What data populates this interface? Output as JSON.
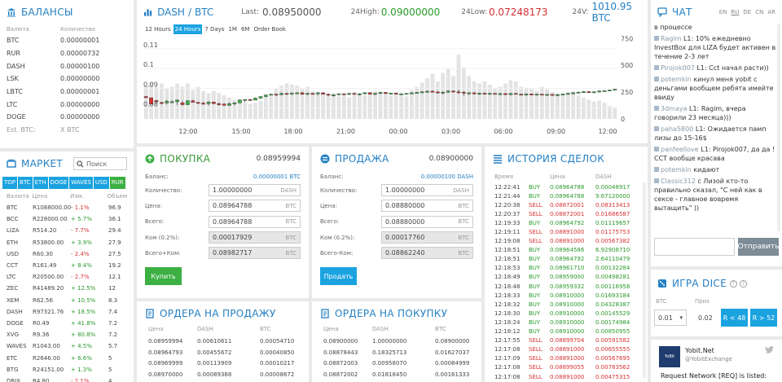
{
  "balances": {
    "title": "БАЛАНСЫ",
    "col_currency": "Валюта",
    "col_amount": "Количество",
    "rows": [
      [
        "BTC",
        "0.00000001"
      ],
      [
        "RUR",
        "0.00000732"
      ],
      [
        "DASH",
        "0.00000100"
      ],
      [
        "LSK",
        "0.00000000"
      ],
      [
        "LBTC",
        "0.00000001"
      ],
      [
        "LTC",
        "0.00000000"
      ],
      [
        "DOGE",
        "0.00000000"
      ]
    ],
    "est_label": "Est. BTC:",
    "est_value": "X BTC"
  },
  "market": {
    "title": "МАРКЕТ",
    "search_placeholder": "Поиск",
    "tabs": [
      "TOP",
      "BTC",
      "ETH",
      "DOGE",
      "WAVES",
      "USD",
      "RUR"
    ],
    "col_currency": "Валюта",
    "col_price": "Цена",
    "col_change": "Изм.",
    "col_volume": "Объем",
    "rows": [
      [
        "BTC",
        "R1088000.00",
        "- 1.1%",
        "96.9"
      ],
      [
        "BCC",
        "R228000.00",
        "+ 5.7%",
        "36.1"
      ],
      [
        "LIZA",
        "R514.20",
        "- 7.7%",
        "29.4"
      ],
      [
        "ETH",
        "R53800.00",
        "+ 3.9%",
        "27.9"
      ],
      [
        "USD",
        "R60.30",
        "- 2.4%",
        "27.5"
      ],
      [
        "CCT",
        "R161.49",
        "+ 8.4%",
        "19.2"
      ],
      [
        "LTC",
        "R20500.00",
        "- 2.7%",
        "12.1"
      ],
      [
        "ZEC",
        "R41489.20",
        "+ 12.5%",
        "12"
      ],
      [
        "XEM",
        "R62.56",
        "+ 10.5%",
        "8.3"
      ],
      [
        "DASH",
        "R97321.76",
        "+ 18.5%",
        "7.4"
      ],
      [
        "DOGE",
        "R0.49",
        "+ 41.8%",
        "7.2"
      ],
      [
        "XVG",
        "R9.36",
        "+ 80.8%",
        "7.2"
      ],
      [
        "WAVES",
        "R1043.00",
        "+ 4.5%",
        "5.7"
      ],
      [
        "ETC",
        "R2646.00",
        "+ 6.6%",
        "5"
      ],
      [
        "BTG",
        "R24151.00",
        "+ 1.3%",
        "5"
      ],
      [
        "DBIX",
        "R4.80",
        "- 2.1%",
        "4"
      ]
    ]
  },
  "ticker": {
    "pair_base": "DASH",
    "pair_sep": "/",
    "pair_quote": "BTC",
    "last_label": "Last:",
    "last_value": "0.08950000",
    "high_label": "24High:",
    "high_value": "0.09000000",
    "low_label": "24Low:",
    "low_value": "0.07248173",
    "vol_label": "24V:",
    "vol_value": "1010.95 BTC"
  },
  "chart_tabs": [
    "12 Hours",
    "24 Hours",
    "7 Days",
    "1M",
    "6M",
    "Order Book"
  ],
  "chart_data": {
    "type": "candlestick",
    "x_ticks": [
      "12:00",
      "15:00",
      "18:00",
      "21:00",
      "00:00",
      "03:00",
      "06:00",
      "09:00",
      "12:00"
    ],
    "y_ticks": [
      "0.11",
      "0.1",
      "0.09",
      "0.08"
    ],
    "y2_ticks": [
      "750",
      "500",
      "250",
      "0"
    ],
    "ylim": [
      0.0745,
      0.1165
    ],
    "y2lim": [
      0,
      775
    ],
    "candles": [
      [
        0.0858,
        0.0858,
        0.0852,
        0.0851,
        0.0861,
        310
      ],
      [
        0.0852,
        0.0838,
        0.082,
        0.0822,
        0.0836,
        340
      ],
      [
        0.0838,
        0.0828,
        0.0835,
        0.0827,
        0.084,
        300
      ],
      [
        0.0828,
        0.082,
        0.0826,
        0.0818,
        0.0831,
        330
      ],
      [
        0.0826,
        0.082,
        0.0834,
        0.0818,
        0.0842,
        280
      ],
      [
        0.0831,
        0.0826,
        0.0832,
        0.0824,
        0.0839,
        300
      ],
      [
        0.0832,
        0.0819,
        0.084,
        0.0816,
        0.0844,
        330
      ],
      [
        0.0826,
        0.0831,
        0.0817,
        0.0813,
        0.0837,
        300
      ],
      [
        0.0817,
        0.0831,
        0.0837,
        0.0815,
        0.0839,
        330
      ],
      [
        0.0837,
        0.084,
        0.0829,
        0.0828,
        0.0842,
        270
      ],
      [
        0.0829,
        0.082,
        0.0824,
        0.0818,
        0.0828,
        300
      ],
      [
        0.0824,
        0.083,
        0.0822,
        0.082,
        0.0832,
        260
      ],
      [
        0.0822,
        0.0816,
        0.083,
        0.0813,
        0.0835,
        240
      ],
      [
        0.083,
        0.0826,
        0.0822,
        0.082,
        0.0832,
        260
      ],
      [
        0.0822,
        0.0814,
        0.082,
        0.0812,
        0.0827,
        240
      ],
      [
        0.082,
        0.0812,
        0.0814,
        0.081,
        0.0824,
        220
      ],
      [
        0.0814,
        0.0812,
        0.0822,
        0.081,
        0.0828,
        200
      ],
      [
        0.0822,
        0.0815,
        0.0826,
        0.0813,
        0.083,
        180
      ],
      [
        0.0826,
        0.0833,
        0.0841,
        0.0823,
        0.0844,
        170
      ],
      [
        0.0841,
        0.0831,
        0.0843,
        0.0829,
        0.0846,
        150
      ],
      [
        0.0843,
        0.0838,
        0.084,
        0.0835,
        0.0847,
        140
      ],
      [
        0.084,
        0.0842,
        0.085,
        0.0839,
        0.0854,
        150
      ],
      [
        0.085,
        0.0847,
        0.0858,
        0.0845,
        0.0861,
        170
      ],
      [
        0.0858,
        0.0856,
        0.0866,
        0.0853,
        0.0869,
        200
      ],
      [
        0.0866,
        0.0867,
        0.087,
        0.0863,
        0.0873,
        230
      ],
      [
        0.087,
        0.0862,
        0.0868,
        0.086,
        0.0873,
        280
      ],
      [
        0.0868,
        0.0866,
        0.0874,
        0.0864,
        0.0878,
        310
      ],
      [
        0.0874,
        0.0868,
        0.0872,
        0.0866,
        0.0877,
        330
      ],
      [
        0.0872,
        0.0867,
        0.0876,
        0.0865,
        0.0879,
        320
      ],
      [
        0.0876,
        0.0872,
        0.0877,
        0.087,
        0.088,
        310
      ],
      [
        0.0877,
        0.088,
        0.087,
        0.0866,
        0.0882,
        280
      ],
      [
        0.087,
        0.0868,
        0.0874,
        0.0866,
        0.0877,
        300
      ],
      [
        0.0874,
        0.0869,
        0.0873,
        0.0867,
        0.0876,
        260
      ],
      [
        0.0873,
        0.0866,
        0.0877,
        0.0864,
        0.088,
        250
      ],
      [
        0.0877,
        0.0873,
        0.087,
        0.0868,
        0.088,
        240
      ],
      [
        0.087,
        0.0862,
        0.0865,
        0.086,
        0.0873,
        230
      ],
      [
        0.0865,
        0.086,
        0.0867,
        0.0858,
        0.087,
        240
      ],
      [
        0.0867,
        0.0865,
        0.0872,
        0.0863,
        0.0875,
        210
      ],
      [
        0.0872,
        0.087,
        0.0869,
        0.0866,
        0.0876,
        230
      ],
      [
        0.0869,
        0.0866,
        0.0874,
        0.0864,
        0.0877,
        200
      ],
      [
        0.0874,
        0.0872,
        0.087,
        0.0868,
        0.0877,
        250
      ],
      [
        0.087,
        0.0866,
        0.0872,
        0.0864,
        0.0875,
        240
      ],
      [
        0.0872,
        0.087,
        0.0878,
        0.0868,
        0.088,
        220
      ],
      [
        0.0878,
        0.0876,
        0.087,
        0.0868,
        0.088,
        230
      ],
      [
        0.087,
        0.0867,
        0.0874,
        0.0865,
        0.0877,
        260
      ],
      [
        0.0874,
        0.0872,
        0.0879,
        0.087,
        0.0882,
        250
      ],
      [
        0.0879,
        0.0876,
        0.0873,
        0.0871,
        0.0881,
        240
      ],
      [
        0.0873,
        0.087,
        0.0875,
        0.0868,
        0.0878,
        220
      ],
      [
        0.0875,
        0.0873,
        0.0871,
        0.0869,
        0.0877,
        250
      ],
      [
        0.0871,
        0.0869,
        0.0872,
        0.0867,
        0.0875,
        230
      ],
      [
        0.0872,
        0.087,
        0.0874,
        0.0868,
        0.0876,
        210
      ],
      [
        0.0874,
        0.0872,
        0.0877,
        0.087,
        0.088,
        270
      ],
      [
        0.0877,
        0.0875,
        0.0879,
        0.0873,
        0.0882,
        300
      ],
      [
        0.0879,
        0.0877,
        0.0882,
        0.0875,
        0.0885,
        340
      ],
      [
        0.0882,
        0.088,
        0.0885,
        0.0878,
        0.0889,
        380
      ],
      [
        0.0885,
        0.0887,
        0.0881,
        0.0879,
        0.089,
        420
      ],
      [
        0.0881,
        0.0883,
        0.0876,
        0.0874,
        0.0887,
        350
      ],
      [
        0.0876,
        0.0874,
        0.088,
        0.087,
        0.0885,
        430
      ],
      [
        0.088,
        0.0878,
        0.0886,
        0.0876,
        0.089,
        470
      ],
      [
        0.0886,
        0.088,
        0.0882,
        0.0878,
        0.0888,
        400
      ],
      [
        0.0882,
        0.0886,
        0.088,
        0.0872,
        0.0893,
        600
      ],
      [
        0.088,
        0.0882,
        0.0876,
        0.0862,
        0.0886,
        480
      ],
      [
        0.0876,
        0.0872,
        0.0877,
        0.0866,
        0.088,
        400
      ],
      [
        0.0877,
        0.0875,
        0.0872,
        0.0868,
        0.088,
        350
      ],
      [
        0.0872,
        0.087,
        0.0875,
        0.0867,
        0.0878,
        330
      ],
      [
        0.0875,
        0.0873,
        0.0871,
        0.0869,
        0.0878,
        350
      ],
      [
        0.0871,
        0.0869,
        0.0874,
        0.0867,
        0.0877,
        320
      ],
      [
        0.0874,
        0.0872,
        0.087,
        0.0868,
        0.0876,
        290
      ],
      [
        0.087,
        0.0867,
        0.0873,
        0.0865,
        0.0876,
        300
      ],
      [
        0.0873,
        0.0871,
        0.0868,
        0.0866,
        0.0875,
        330
      ],
      [
        0.0868,
        0.0866,
        0.0874,
        0.0864,
        0.0877,
        360
      ],
      [
        0.0874,
        0.0872,
        0.087,
        0.0868,
        0.0876,
        350
      ],
      [
        0.087,
        0.0868,
        0.0866,
        0.0864,
        0.0873,
        300
      ],
      [
        0.0866,
        0.0864,
        0.0871,
        0.0862,
        0.0874,
        290
      ],
      [
        0.0871,
        0.0869,
        0.0867,
        0.0865,
        0.0873,
        280
      ],
      [
        0.0867,
        0.0865,
        0.087,
        0.0863,
        0.0873,
        260
      ],
      [
        0.087,
        0.0868,
        0.0866,
        0.0864,
        0.0872,
        300
      ],
      [
        0.0866,
        0.0864,
        0.0869,
        0.0862,
        0.0872,
        280
      ],
      [
        0.0869,
        0.0867,
        0.0864,
        0.0862,
        0.0871,
        250
      ],
      [
        0.0864,
        0.0862,
        0.0868,
        0.086,
        0.0871,
        240
      ],
      [
        0.0868,
        0.0866,
        0.0871,
        0.0864,
        0.0874,
        230
      ],
      [
        0.0871,
        0.0869,
        0.0874,
        0.0867,
        0.0877,
        250
      ],
      [
        0.0874,
        0.0872,
        0.0877,
        0.087,
        0.088,
        260
      ],
      [
        0.0877,
        0.0875,
        0.088,
        0.0873,
        0.0884,
        220
      ],
      [
        0.088,
        0.0878,
        0.0883,
        0.0876,
        0.0886,
        200
      ],
      [
        0.0883,
        0.0881,
        0.0878,
        0.0876,
        0.0885,
        180
      ],
      [
        0.0878,
        0.0877,
        0.0882,
        0.0875,
        0.0885,
        160
      ],
      [
        0.0882,
        0.088,
        0.0886,
        0.0878,
        0.0889,
        170
      ],
      [
        0.0886,
        0.0884,
        0.0888,
        0.0882,
        0.0891,
        150
      ],
      [
        0.0888,
        0.0887,
        0.0891,
        0.0885,
        0.0893,
        120
      ],
      [
        0.0891,
        0.089,
        0.0895,
        0.0888,
        0.0897,
        110
      ]
    ]
  },
  "buy": {
    "title": "ПОКУПКА",
    "price": "0.08959994",
    "balance_label": "Баланс:",
    "balance_value": "0.00000001 BTC",
    "qty_label": "Количество:",
    "qty_value": "1.00000000",
    "qty_unit": "DASH",
    "price_label": "Цена:",
    "price_value": "0.08964788",
    "price_unit": "BTC",
    "total_label": "Всего:",
    "total_value": "0.08964788",
    "total_unit": "BTC",
    "fee_label": "Ком (0.2%):",
    "fee_value": "0.00017929",
    "fee_unit": "BTC",
    "totalfee_label": "Всего+Ком:",
    "totalfee_value": "0.08982717",
    "totalfee_unit": "BTC",
    "button": "Купить"
  },
  "sell": {
    "title": "ПРОДАЖА",
    "price": "0.08900000",
    "balance_label": "Баланс:",
    "balance_value": "0.00000100 DASH",
    "qty_label": "Количество:",
    "qty_value": "1.00000000",
    "qty_unit": "DASH",
    "price_label": "Цена:",
    "price_value": "0.08880000",
    "price_unit": "BTC",
    "total_label": "Всего:",
    "total_value": "0.08880000",
    "total_unit": "BTC",
    "fee_label": "Ком (0.2%):",
    "fee_value": "0.00017760",
    "fee_unit": "BTC",
    "totalfee_label": "Всего-Ком:",
    "totalfee_value": "0.08862240",
    "totalfee_unit": "BTC",
    "button": "Продать"
  },
  "sell_orders": {
    "title": "ОРДЕРА НА ПРОДАЖУ",
    "col_price": "Цена",
    "col_dash": "DASH",
    "col_btc": "BTC",
    "rows": [
      [
        "0.08959994",
        "0.00610611",
        "0.00054710"
      ],
      [
        "0.08964793",
        "0.00455672",
        "0.00040850"
      ],
      [
        "0.08969999",
        "0.00113909",
        "0.00010217"
      ],
      [
        "0.08970000",
        "0.00089368",
        "0.00008672"
      ]
    ]
  },
  "buy_orders": {
    "title": "ОРДЕРА НА ПОКУПКУ",
    "col_price": "Цена",
    "col_dash": "DASH",
    "col_btc": "BTC",
    "rows": [
      [
        "0.08900000",
        "1.00000000",
        "0.08900000"
      ],
      [
        "0.08878443",
        "0.18325713",
        "0.01627037"
      ],
      [
        "0.08872003",
        "0.00958070",
        "0.00084999"
      ],
      [
        "0.08872002",
        "0.01818450",
        "0.00161333"
      ]
    ]
  },
  "history": {
    "title": "ИСТОРИЯ СДЕЛОК",
    "col_time": "Время",
    "col_price": "Цена",
    "col_dash": "DASH",
    "rows": [
      [
        "12:22:41",
        "BUY",
        "0.08964788",
        "0.00048917"
      ],
      [
        "12:21:44",
        "BUY",
        "0.08964788",
        "9.67120000"
      ],
      [
        "12:20:38",
        "SELL",
        "0.08872001",
        "0.08313413"
      ],
      [
        "12:20:37",
        "SELL",
        "0.08872001",
        "0.01686587"
      ],
      [
        "12:19:33",
        "BUY",
        "0.08964792",
        "0.01119657"
      ],
      [
        "12:19:11",
        "SELL",
        "0.08891000",
        "0.01175753"
      ],
      [
        "12:19:08",
        "SELL",
        "0.08891000",
        "0.00567382"
      ],
      [
        "12:18:51",
        "BUY",
        "0.08964586",
        "6.92908710"
      ],
      [
        "12:18:51",
        "BUY",
        "0.08964792",
        "2.64110479"
      ],
      [
        "12:18:53",
        "BUY",
        "0.08961710",
        "0.00132284"
      ],
      [
        "12:18:49",
        "BUY",
        "0.08959000",
        "0.00498281"
      ],
      [
        "12:18:48",
        "BUY",
        "0.08959332",
        "0.00116958"
      ],
      [
        "12:18:33",
        "BUY",
        "0.08910000",
        "0.01693184"
      ],
      [
        "12:18:32",
        "BUY",
        "0.08910000",
        "0.04328387"
      ],
      [
        "12:18:30",
        "BUY",
        "0.08910000",
        "0.00145529"
      ],
      [
        "12:18:24",
        "BUY",
        "0.08910000",
        "0.00174984"
      ],
      [
        "12:18:12",
        "BUY",
        "0.08910000",
        "0.00850955"
      ],
      [
        "12:17:55",
        "SELL",
        "0.08899704",
        "0.00591582"
      ],
      [
        "12:17:08",
        "SELL",
        "0.08891000",
        "0.00655555"
      ],
      [
        "12:17:09",
        "SELL",
        "0.08891000",
        "0.00567695"
      ],
      [
        "12:17:08",
        "SELL",
        "0.08899055",
        "0.00783562"
      ],
      [
        "12:17:08",
        "SELL",
        "0.08891000",
        "0.00475315"
      ]
    ]
  },
  "chat": {
    "title": "ЧАТ",
    "langs": [
      "EN",
      "RU",
      "DE",
      "CN",
      "AR"
    ],
    "active_lang": "RU",
    "messages": [
      {
        "user": "",
        "text": "в процессе"
      },
      {
        "user": "Ragim",
        "text": "L1: 10% ежедневно InvestBox для LIZA будет активен в течение 2-3 лет"
      },
      {
        "user": "Pirojok007",
        "text": "L1: Cct начал расти))"
      },
      {
        "user": "potemkin",
        "text": "кинул меня yobit с деньгами вообщем ребята имейте ввиду"
      },
      {
        "user": "3dmaya",
        "text": "L1: Ragim, вчера говорили 23 месяца)))"
      },
      {
        "user": "paha5800",
        "text": "L1: Ожидается памп лизы до 15-16$"
      },
      {
        "user": "panfeellove",
        "text": "L1: Pirojok007, да да ! CCT вообще красава"
      },
      {
        "user": "potemkin",
        "text": "кидают"
      },
      {
        "user": "Classic312",
        "text": "с Лизой кто-то правильно сказал, \"С ней как в сексе - главное вовремя вытащить\" ))"
      }
    ],
    "send_button": "Отправить"
  },
  "dice": {
    "title": "ИГРА DICE",
    "col_bet": "BTC",
    "col_prize": "Приз",
    "bet_value": "0.01",
    "prize_value": "0.02",
    "btn_low": "R < 48",
    "btn_high": "R > 52"
  },
  "twitter": {
    "name": "Yobit.Net",
    "handle": "@YobitExchange",
    "text": "Request Network [REQ] is listed:",
    "avatar": "YoBit"
  },
  "colors": {
    "accent": "#2580c3",
    "buy": "#3cb043",
    "sell": "#d83030",
    "button_blue": "#1ba3e0"
  }
}
